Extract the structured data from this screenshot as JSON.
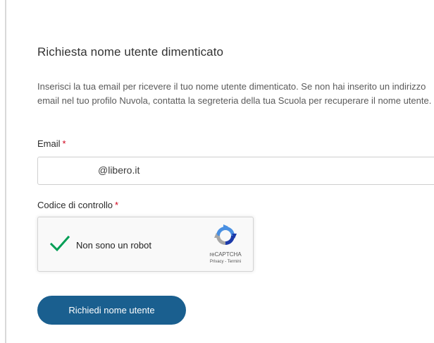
{
  "form": {
    "title": "Richiesta nome utente dimenticato",
    "instructions": "Inserisci la tua email per ricevere il tuo nome utente dimenticato. Se non hai inserito un indirizzo email nel tuo profilo Nuvola, contatta la segreteria della tua Scuola per recuperare il nome utente.",
    "email_label": "Email",
    "email_value": "@libero.it",
    "required_marker": "*",
    "captcha_label": "Codice di controllo",
    "submit_label": "Richiedi nome utente"
  },
  "recaptcha": {
    "label": "Non sono un robot",
    "checked": true,
    "brand": "reCAPTCHA",
    "links": "Privacy - Termini"
  },
  "colors": {
    "accent": "#1a5f8f",
    "required": "#d0021b",
    "check": "#009e55"
  }
}
